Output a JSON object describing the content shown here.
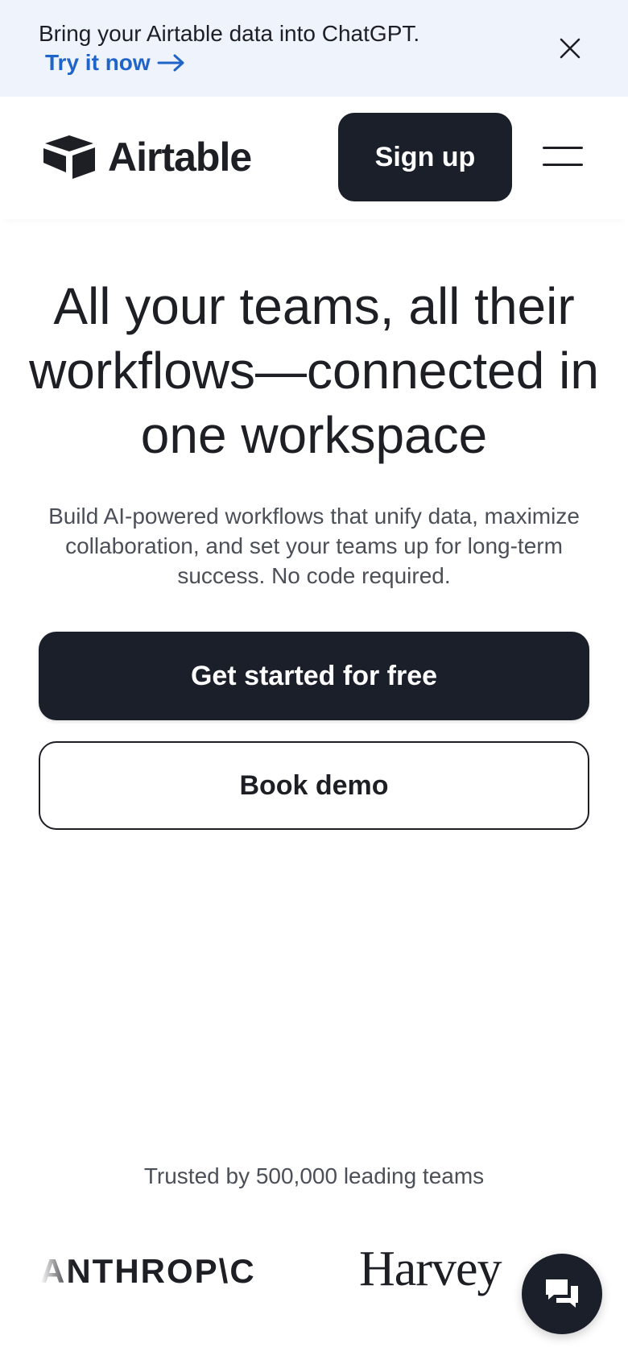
{
  "banner": {
    "text": "Bring your Airtable data into ChatGPT.",
    "link_label": "Try it now",
    "link_color": "#1f64c8",
    "close_icon": "close-icon",
    "background": "#eef3fc"
  },
  "header": {
    "logo_text": "Airtable",
    "signup_label": "Sign up",
    "menu_icon": "hamburger-menu-icon"
  },
  "hero": {
    "title": "All your teams, all their workflows—connected in one workspace",
    "subtitle": "Build AI-powered workflows that unify data, maximize collaboration, and set your teams up for long-term success. No code required.",
    "primary_cta": "Get started for free",
    "secondary_cta": "Book demo"
  },
  "trusted": {
    "text": "Trusted by 500,000 leading teams",
    "logos": [
      "ANTHROP\\C",
      "Harvey"
    ]
  },
  "chat": {
    "icon": "chat-bubbles-icon"
  },
  "colors": {
    "dark": "#1b1f29",
    "text": "#1d1f25",
    "muted": "#4b4f58"
  }
}
